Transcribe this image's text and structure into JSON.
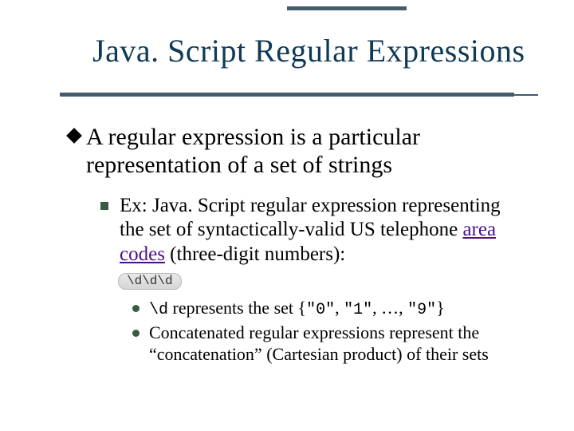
{
  "title": "Java. Script Regular Expressions",
  "l1": "A regular expression is a particular representation of a set of strings",
  "l2_pre": "Ex: Java. Script regular expression representing the set of syntactically-valid US telephone ",
  "l2_link": "area codes",
  "l2_post": " (three-digit numbers):",
  "code": "\\d\\d\\d",
  "l3a_code": "\\d",
  "l3a_mid": " represents the set {",
  "l3a_s0": "\"0\"",
  "l3a_c1": ", ",
  "l3a_s1": "\"1\"",
  "l3a_c2": ", …, ",
  "l3a_s9": "\"9\"",
  "l3a_end": "}",
  "l3b": "Concatenated regular expressions represent the “concatenation” (Cartesian product) of their sets"
}
